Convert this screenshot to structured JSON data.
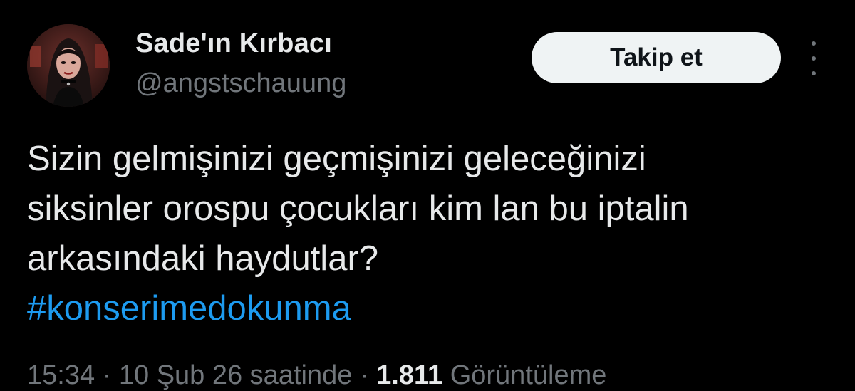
{
  "user": {
    "display_name": "Sade'ın Kırbacı",
    "handle": "@angstschauung",
    "avatar_icon": "profile-photo"
  },
  "follow_button": {
    "label": "Takip et"
  },
  "more_button": {
    "icon": "more-vertical-icon"
  },
  "tweet": {
    "lines": [
      "Sizin gelmişinizi geçmişinizi geleceğinizi",
      "siksinler orospu çocukları kim lan bu iptalin",
      "arkasındaki haydutlar?"
    ],
    "hashtag": "#konserimedokunma"
  },
  "meta": {
    "time_date": "15:34 · 10 Şub 26 saatinde ·",
    "views_count": "1.811",
    "views_label": "Görüntüleme"
  },
  "colors": {
    "background": "#000000",
    "text": "#e7e9ea",
    "secondary_text": "#71767b",
    "link": "#1d9bf0",
    "button_bg": "#eff3f4"
  }
}
